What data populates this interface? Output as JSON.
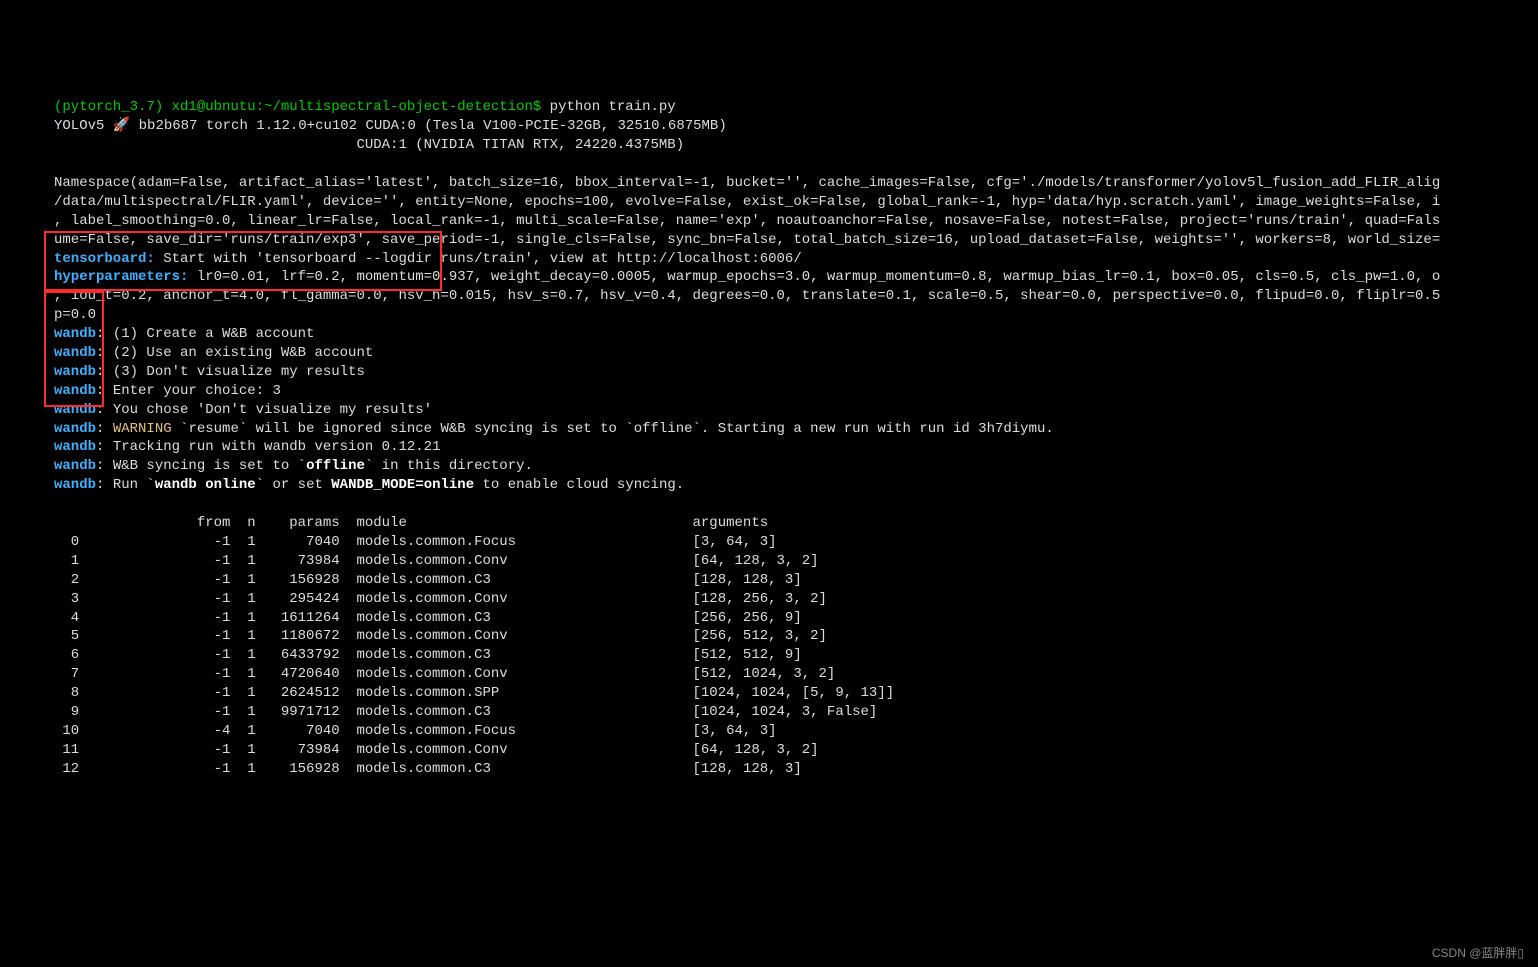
{
  "prompt": "(pytorch_3.7) xd1@ubnutu:~/multispectral-object-detection$",
  "command": " python train.py",
  "line_yolo": "YOLOv5 🚀 bb2b687 torch 1.12.0+cu102 CUDA:0 (Tesla V100-PCIE-32GB, 32510.6875MB)",
  "line_cuda2": "                                    CUDA:1 (NVIDIA TITAN RTX, 24220.4375MB)",
  "blank": "",
  "ns1": "Namespace(adam=False, artifact_alias='latest', batch_size=16, bbox_interval=-1, bucket='', cache_images=False, cfg='./models/transformer/yolov5l_fusion_add_FLIR_alig",
  "ns2": "/data/multispectral/FLIR.yaml', device='', entity=None, epochs=100, evolve=False, exist_ok=False, global_rank=-1, hyp='data/hyp.scratch.yaml', image_weights=False, i",
  "ns3": ", label_smoothing=0.0, linear_lr=False, local_rank=-1, multi_scale=False, name='exp', noautoanchor=False, nosave=False, notest=False, project='runs/train', quad=Fals",
  "ns4": "ume=False, save_dir='runs/train/exp3', save_period=-1, single_cls=False, sync_bn=False, total_batch_size=16, upload_dataset=False, weights='', workers=8, world_size=",
  "tb_label": "tensorboard:",
  "tb_text": " Start with 'tensorboard --logdir runs/train', view at http://localhost:6006/",
  "hp_label": "hyperparameters:",
  "hp_text1": " lr0=0.01, lrf=0.2, momentum=0.937, weight_decay=0.0005, warmup_epochs=3.0, warmup_momentum=0.8, warmup_bias_lr=0.1, box=0.05, cls=0.5, cls_pw=1.0, o",
  "hp_text2": ", iou_t=0.2, anchor_t=4.0, fl_gamma=0.0, hsv_h=0.015, hsv_s=0.7, hsv_v=0.4, degrees=0.0, translate=0.1, scale=0.5, shear=0.0, perspective=0.0, flipud=0.0, fliplr=0.5",
  "hp_text3": "p=0.0",
  "wandb_label": "wandb",
  "w1": ": (1) Create a W&B account",
  "w2": ": (2) Use an existing W&B account",
  "w3": ": (3) Don't visualize my results",
  "w4": ": Enter your choice: 3",
  "w5": ": You chose 'Don't visualize my results'",
  "warn_label": "WARNING",
  "w6_pre": ": ",
  "w6_post": " `resume` will be ignored since W&B syncing is set to `offline`. Starting a new run with run id 3h7diymu.",
  "w7": ": Tracking run with wandb version 0.12.21",
  "w8a": ": W&B syncing is set to `",
  "w8b": "offline",
  "w8c": "` in this directory.",
  "w9a": ": Run `",
  "w9b": "wandb online",
  "w9c": "` or set ",
  "w9d": "WANDB_MODE=online",
  "w9e": " to enable cloud syncing.",
  "table_header": "                 from  n    params  module                                  arguments",
  "rows": [
    "  0                -1  1      7040  models.common.Focus                     [3, 64, 3]",
    "  1                -1  1     73984  models.common.Conv                      [64, 128, 3, 2]",
    "  2                -1  1    156928  models.common.C3                        [128, 128, 3]",
    "  3                -1  1    295424  models.common.Conv                      [128, 256, 3, 2]",
    "  4                -1  1   1611264  models.common.C3                        [256, 256, 9]",
    "  5                -1  1   1180672  models.common.Conv                      [256, 512, 3, 2]",
    "  6                -1  1   6433792  models.common.C3                        [512, 512, 9]",
    "  7                -1  1   4720640  models.common.Conv                      [512, 1024, 3, 2]",
    "  8                -1  1   2624512  models.common.SPP                       [1024, 1024, [5, 9, 13]]",
    "  9                -1  1   9971712  models.common.C3                        [1024, 1024, 3, False]",
    " 10                -4  1      7040  models.common.Focus                     [3, 64, 3]",
    " 11                -1  1     73984  models.common.Conv                      [64, 128, 3, 2]",
    " 12                -1  1    156928  models.common.C3                        [128, 128, 3]"
  ],
  "watermark": "CSDN @蓝胖胖▯"
}
